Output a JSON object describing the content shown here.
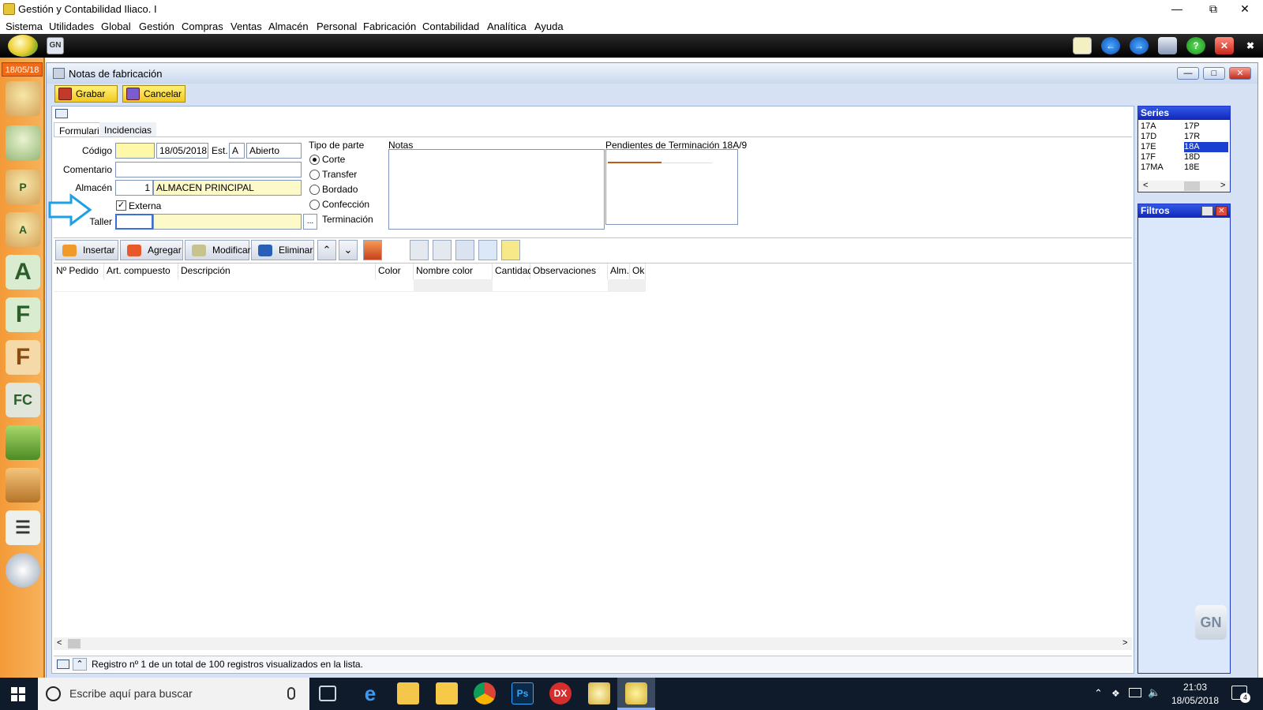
{
  "app": {
    "title": "Gestión y Contabilidad Iliaco. I",
    "menu": [
      "Sistema",
      "Utilidades",
      "Global",
      "Gestión",
      "Compras",
      "Ventas",
      "Almacén",
      "Personal",
      "Fabricación",
      "Contabilidad",
      "Analítica",
      "Ayuda"
    ],
    "date": "18/05/18"
  },
  "window": {
    "title": "Notas de fabricación",
    "save_label": "Grabar",
    "cancel_label": "Cancelar",
    "tabs": [
      "Formulario",
      "Incidencias"
    ]
  },
  "form": {
    "codigo_label": "Código",
    "codigo_value": "",
    "date_value": "18/05/2018",
    "est_label": "Est.",
    "est_code": "A",
    "est_text": "Abierto",
    "comentario_label": "Comentario",
    "comentario_value": "",
    "almacen_label": "Almacén",
    "almacen_num": "1",
    "almacen_name": "ALMACEN PRINCIPAL",
    "externa_label": "Externa",
    "externa_checked": true,
    "taller_label": "Taller",
    "taller_value": "",
    "ellipsis": "...",
    "tipo_label": "Tipo de parte",
    "tipo_options": [
      "Corte",
      "Transfer",
      "Bordado",
      "Confección",
      "Terminación"
    ],
    "tipo_selected": "Corte",
    "notas_label": "Notas",
    "pendientes_label": "Pendientes de Terminación 18A/9"
  },
  "toolbar": {
    "insertar": "Insertar",
    "agregar": "Agregar",
    "modificar": "Modificar",
    "eliminar": "Eliminar"
  },
  "grid": {
    "columns": [
      "Nº Pedido",
      "Art. compuesto",
      "Descripción",
      "Color",
      "Nombre color",
      "Cantidad",
      "Observaciones",
      "Alm.",
      "Ok"
    ]
  },
  "status": {
    "text": "Registro nº 1 de un total de 100 registros visualizados en la lista."
  },
  "series": {
    "title": "Series",
    "col1": [
      "17A",
      "17D",
      "17E",
      "17F",
      "17MA"
    ],
    "col2": [
      "17P",
      "17R",
      "18A",
      "18D",
      "18E"
    ],
    "selected": "18A"
  },
  "filtros": {
    "title": "Filtros"
  },
  "taskbar": {
    "search_placeholder": "Escribe aquí para buscar",
    "time": "21:03",
    "date": "18/05/2018",
    "notif_count": "4"
  }
}
